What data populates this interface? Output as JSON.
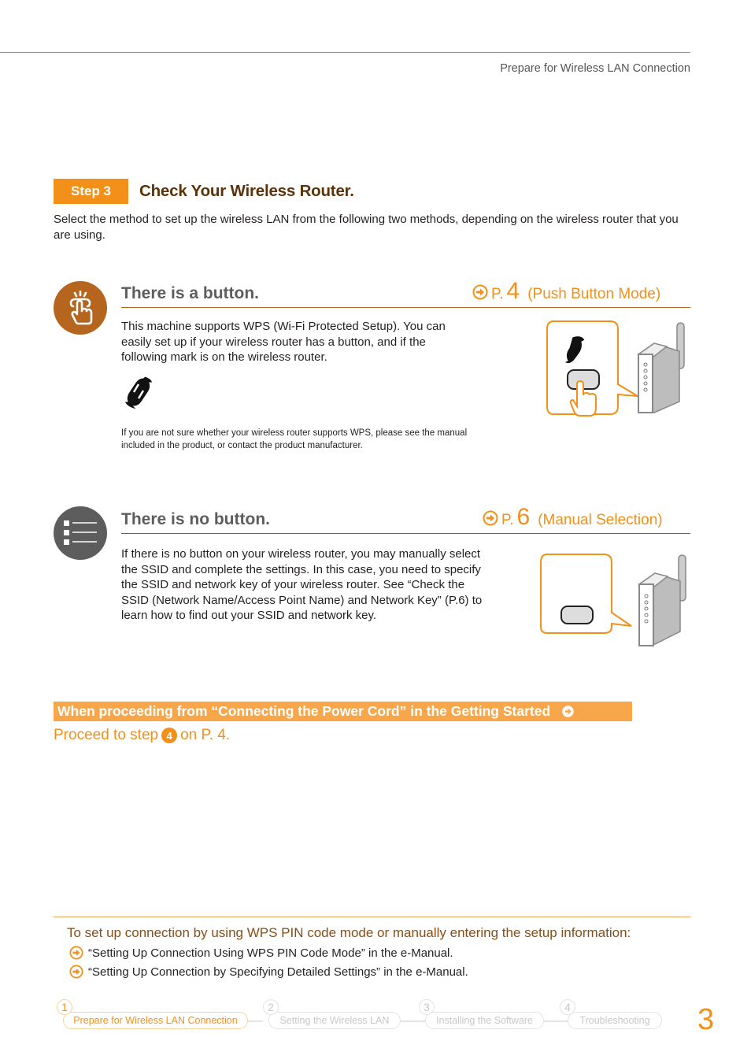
{
  "header": {
    "title": "Prepare for Wireless LAN Connection"
  },
  "step": {
    "badge": "Step 3",
    "title": "Check Your Wireless Router.",
    "intro": "Select the method to set up the wireless LAN from the following two methods, depending on the wireless router that you are using."
  },
  "section_button": {
    "icon": "push-button-hand-icon",
    "title": "There is a button.",
    "ref_prefix": "P.",
    "ref_page": "4",
    "ref_label": "(Push Button Mode)",
    "body": "This machine supports WPS (Wi-Fi Protected Setup). You can easily set up if your wireless router has a button, and if the following mark is on the wireless router.",
    "note": "If you are not sure whether your wireless router supports WPS, please see the manual included in the product, or contact the product manufacturer."
  },
  "section_nobutton": {
    "icon": "list-icon",
    "title": "There is no button.",
    "ref_prefix": "P.",
    "ref_page": "6",
    "ref_label": "(Manual Selection)",
    "body": "If there is no button on your wireless router, you may manually select the SSID and complete the settings. In this case, you need to specify the SSID and network key of your wireless router. See “Check the SSID (Network Name/Access Point Name) and Network Key” (P.6) to learn how to find out your SSID and network key."
  },
  "banner": {
    "text": "When proceeding from “Connecting the Power Cord” in the Getting Started",
    "proceed_prefix": "Proceed to step",
    "proceed_step": "4",
    "proceed_suffix": "on P. 4."
  },
  "setup_info": {
    "title": "To set up connection by using WPS PIN code mode or manually entering the setup information:",
    "links": [
      "“Setting Up Connection Using WPS PIN Code Mode” in the e-Manual.",
      "“Setting Up Connection by Specifying Detailed Settings” in the e-Manual."
    ]
  },
  "nav": {
    "steps": [
      {
        "num": "1",
        "label": "Prepare for Wireless LAN Connection",
        "active": true
      },
      {
        "num": "2",
        "label": "Setting the Wireless LAN",
        "active": false
      },
      {
        "num": "3",
        "label": "Installing the Software",
        "active": false
      },
      {
        "num": "4",
        "label": "Troubleshooting",
        "active": false
      }
    ]
  },
  "page_number": "3",
  "colors": {
    "accent": "#f39019",
    "brown": "#5c3308",
    "button_circle": "#b5651d",
    "gray_circle": "#5d5d5d",
    "banner": "#f7a74a"
  }
}
